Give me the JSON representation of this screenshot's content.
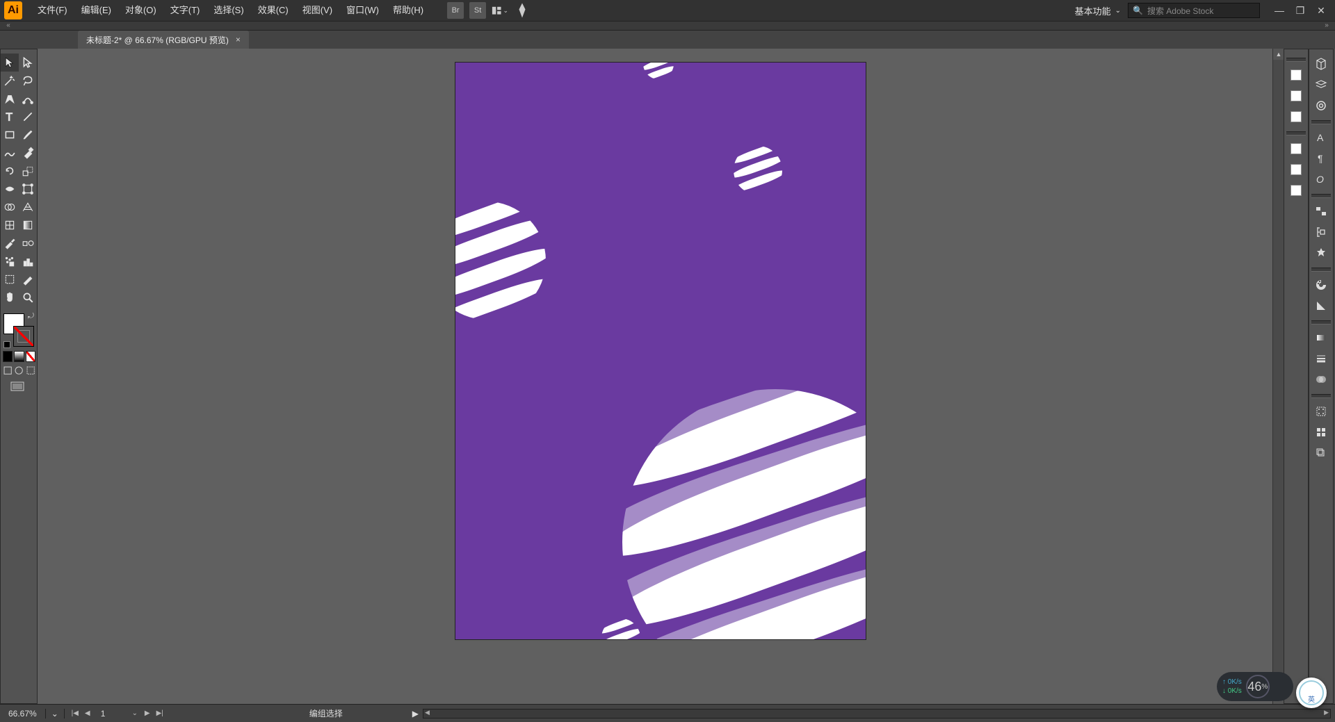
{
  "app": {
    "logo_text": "Ai"
  },
  "menu": {
    "items": [
      "文件(F)",
      "编辑(E)",
      "对象(O)",
      "文字(T)",
      "选择(S)",
      "效果(C)",
      "视图(V)",
      "窗口(W)",
      "帮助(H)"
    ]
  },
  "top_right": {
    "br_label": "Br",
    "st_label": "St",
    "workspace": "基本功能",
    "search_placeholder": "搜索 Adobe Stock"
  },
  "tab": {
    "title": "未标题-2* @ 66.67% (RGB/GPU 预览)"
  },
  "status": {
    "zoom": "66.67%",
    "artboard_num": "1",
    "tool_label": "编组选择"
  },
  "netwidget": {
    "up": "0K/s",
    "down": "0K/s",
    "percent": "46",
    "percent_suffix": "%"
  },
  "ime": {
    "label": "英"
  },
  "colors": {
    "artboard_bg": "#6a3aa0",
    "stripe": "#ffffff",
    "stripe_shadow": "#a58cc7"
  }
}
